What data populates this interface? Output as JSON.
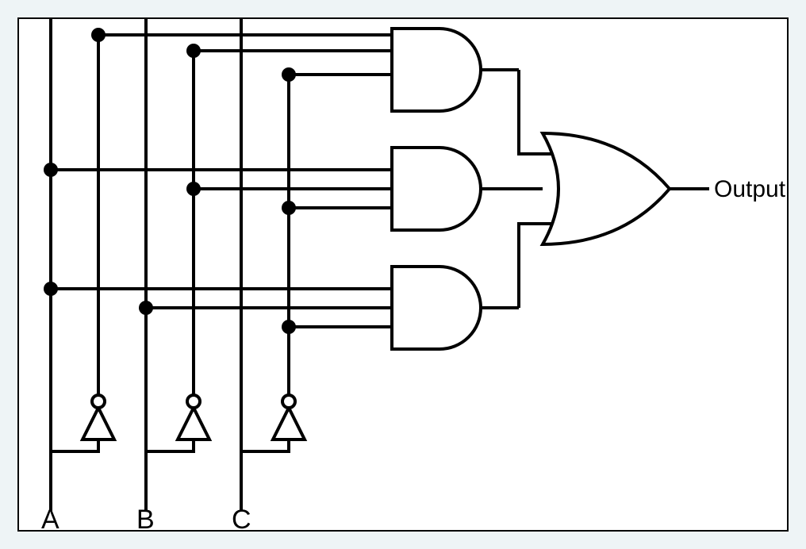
{
  "inputs": {
    "a": "A",
    "b": "B",
    "c": "C"
  },
  "output_label": "Output",
  "gates": {
    "and1": {
      "type": "AND",
      "inputs": [
        "A'",
        "B'",
        "C'"
      ]
    },
    "and2": {
      "type": "AND",
      "inputs": [
        "A",
        "B'",
        "C'"
      ]
    },
    "and3": {
      "type": "AND",
      "inputs": [
        "A",
        "B",
        "C'"
      ]
    },
    "or": {
      "type": "OR",
      "inputs": [
        "and1",
        "and2",
        "and3"
      ]
    }
  },
  "inverters": [
    "A",
    "B",
    "C"
  ]
}
